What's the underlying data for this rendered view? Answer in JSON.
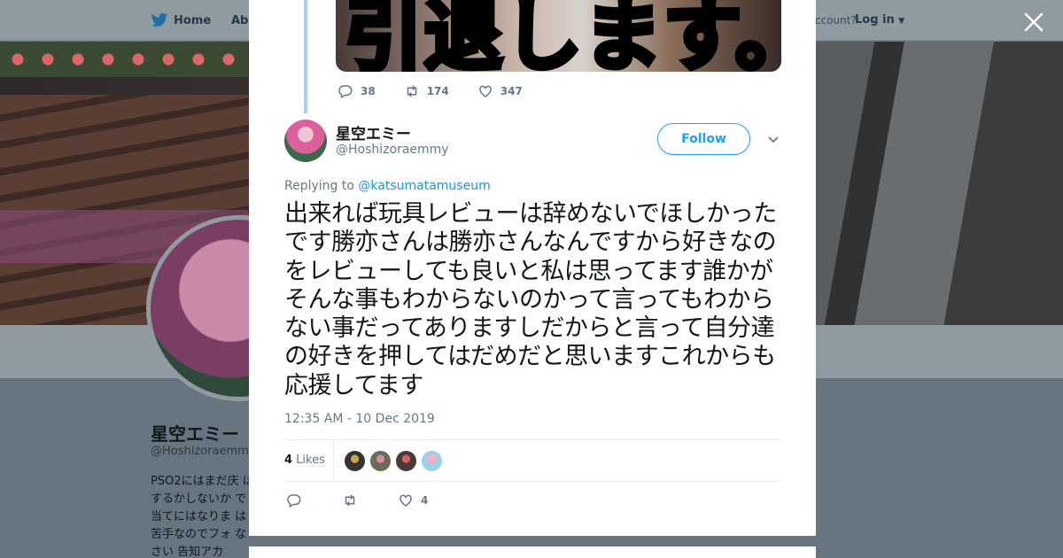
{
  "background_page": {
    "nav": {
      "home_label": "Home",
      "about_label": "Abo",
      "account_label": "ccount?",
      "login_label": "Log in"
    },
    "profile": {
      "name": "星空エミー",
      "handle": "@Hoshizoraemmy",
      "bio": "PSO2にはまだ庆 はするかしないか で当てにはなりま は苦手なのでフォ なさい 告知アカ"
    }
  },
  "close_icon": "close-icon",
  "previous_tweet": {
    "image_text": "引退します。",
    "reply_count": "38",
    "retweet_count": "174",
    "like_count": "347"
  },
  "tweet": {
    "author_name": "星空エミー",
    "author_handle": "@Hoshizoraemmy",
    "follow_label": "Follow",
    "replying_prefix": "Replying to",
    "replying_to": "@katsumatamuseum",
    "text": "出来れば玩具レビューは辞めないでほしかったです勝亦さんは勝亦さんなんですから好きなのをレビューしても良いと私は思ってます誰かがそんな事もわからないのかって言ってもわからない事だってありますしだからと言って自分達の好きを押してはだめだと思いますこれからも応援してます",
    "timestamp": "12:35 AM - 10 Dec 2019",
    "likes_number": "4",
    "likes_label": "Likes",
    "like_count": "4"
  },
  "colors": {
    "accent": "#1da1f2",
    "text": "#14171a",
    "muted": "#657786",
    "thread_line": "#a8d2ef"
  }
}
